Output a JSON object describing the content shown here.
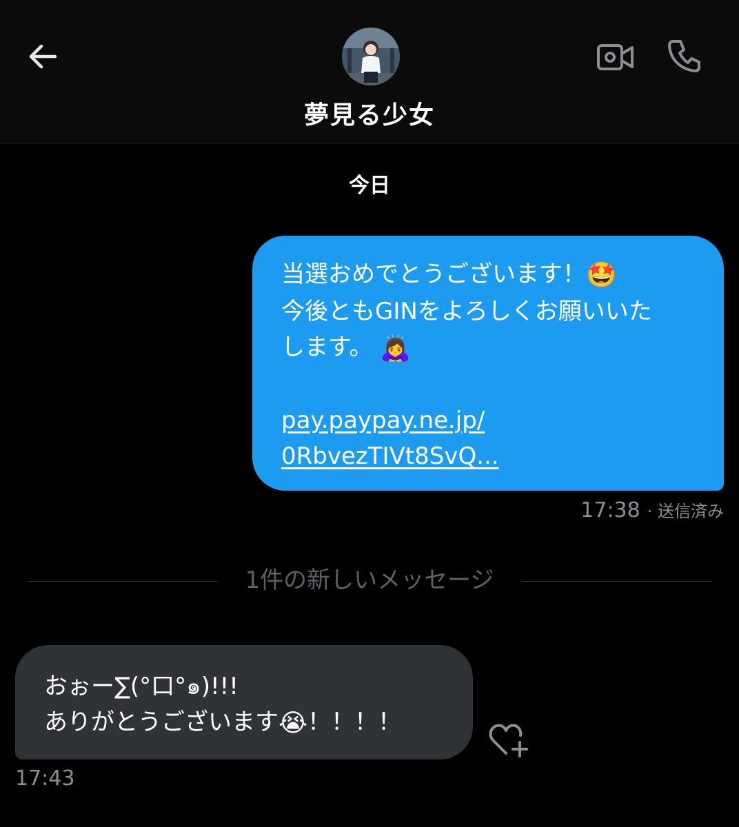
{
  "header": {
    "back_icon": "arrow-left-icon",
    "video_icon": "video-camera-icon",
    "phone_icon": "phone-icon",
    "contact_name": "夢見る少女"
  },
  "date_separator": "今日",
  "sent_message": {
    "line1": "当選おめでとうございます！",
    "line1_emoji": "🤩",
    "line2": "今後ともGINをよろしくお願いいた",
    "line3": "します。",
    "line3_emoji": "🙇‍♀️",
    "link_line1": "pay.paypay.ne.jp/",
    "link_line2": "0RbvezTIVt8SvQ...",
    "time": "17:38",
    "status": "· 送信済み",
    "bubble_color": "#1d9bf0"
  },
  "new_messages_divider": "1件の新しいメッセージ",
  "received_message": {
    "line1": "おぉー∑(°口°๑)!!!",
    "line2": "ありがとうございます",
    "line2_emoji": "😭",
    "line2_suffix": "！！！！",
    "time": "17:43",
    "bubble_color": "#2f3336",
    "react_icon": "heart-plus-icon"
  }
}
